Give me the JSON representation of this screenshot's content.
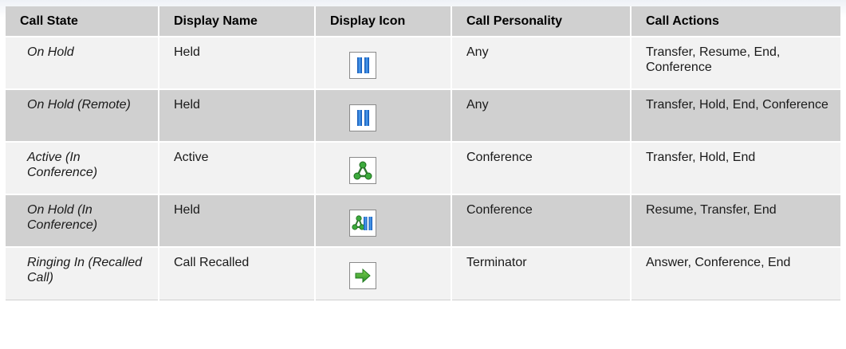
{
  "table": {
    "headers": [
      "Call State",
      "Display Name",
      "Display Icon",
      "Call Personality",
      "Call Actions"
    ],
    "rows": [
      {
        "call_state": "On Hold",
        "display_name": "Held",
        "display_icon": "hold-pause-icon",
        "call_personality": "Any",
        "call_actions": "Transfer, Resume, End, Conference"
      },
      {
        "call_state": "On Hold (Remote)",
        "display_name": "Held",
        "display_icon": "hold-pause-icon",
        "call_personality": "Any",
        "call_actions": "Transfer, Hold, End, Conference"
      },
      {
        "call_state": "Active (In Conference)",
        "display_name": "Active",
        "display_icon": "conference-triangle-icon",
        "call_personality": "Conference",
        "call_actions": "Transfer, Hold, End"
      },
      {
        "call_state": "On Hold (In Conference)",
        "display_name": "Held",
        "display_icon": "conference-hold-icon",
        "call_personality": "Conference",
        "call_actions": "Resume, Transfer, End"
      },
      {
        "call_state": "Ringing In (Recalled Call)",
        "display_name": "Call Recalled",
        "display_icon": "green-arrow-right-icon",
        "call_personality": "Terminator",
        "call_actions": "Answer, Conference, End"
      }
    ]
  },
  "colors": {
    "header_bg": "#d0d0d0",
    "row_light": "#f2f2f2",
    "row_dark": "#d0d0d0",
    "pause_blue": "#1f6fd6",
    "conference_green": "#2f9a2f",
    "arrow_green": "#3aa83a"
  }
}
